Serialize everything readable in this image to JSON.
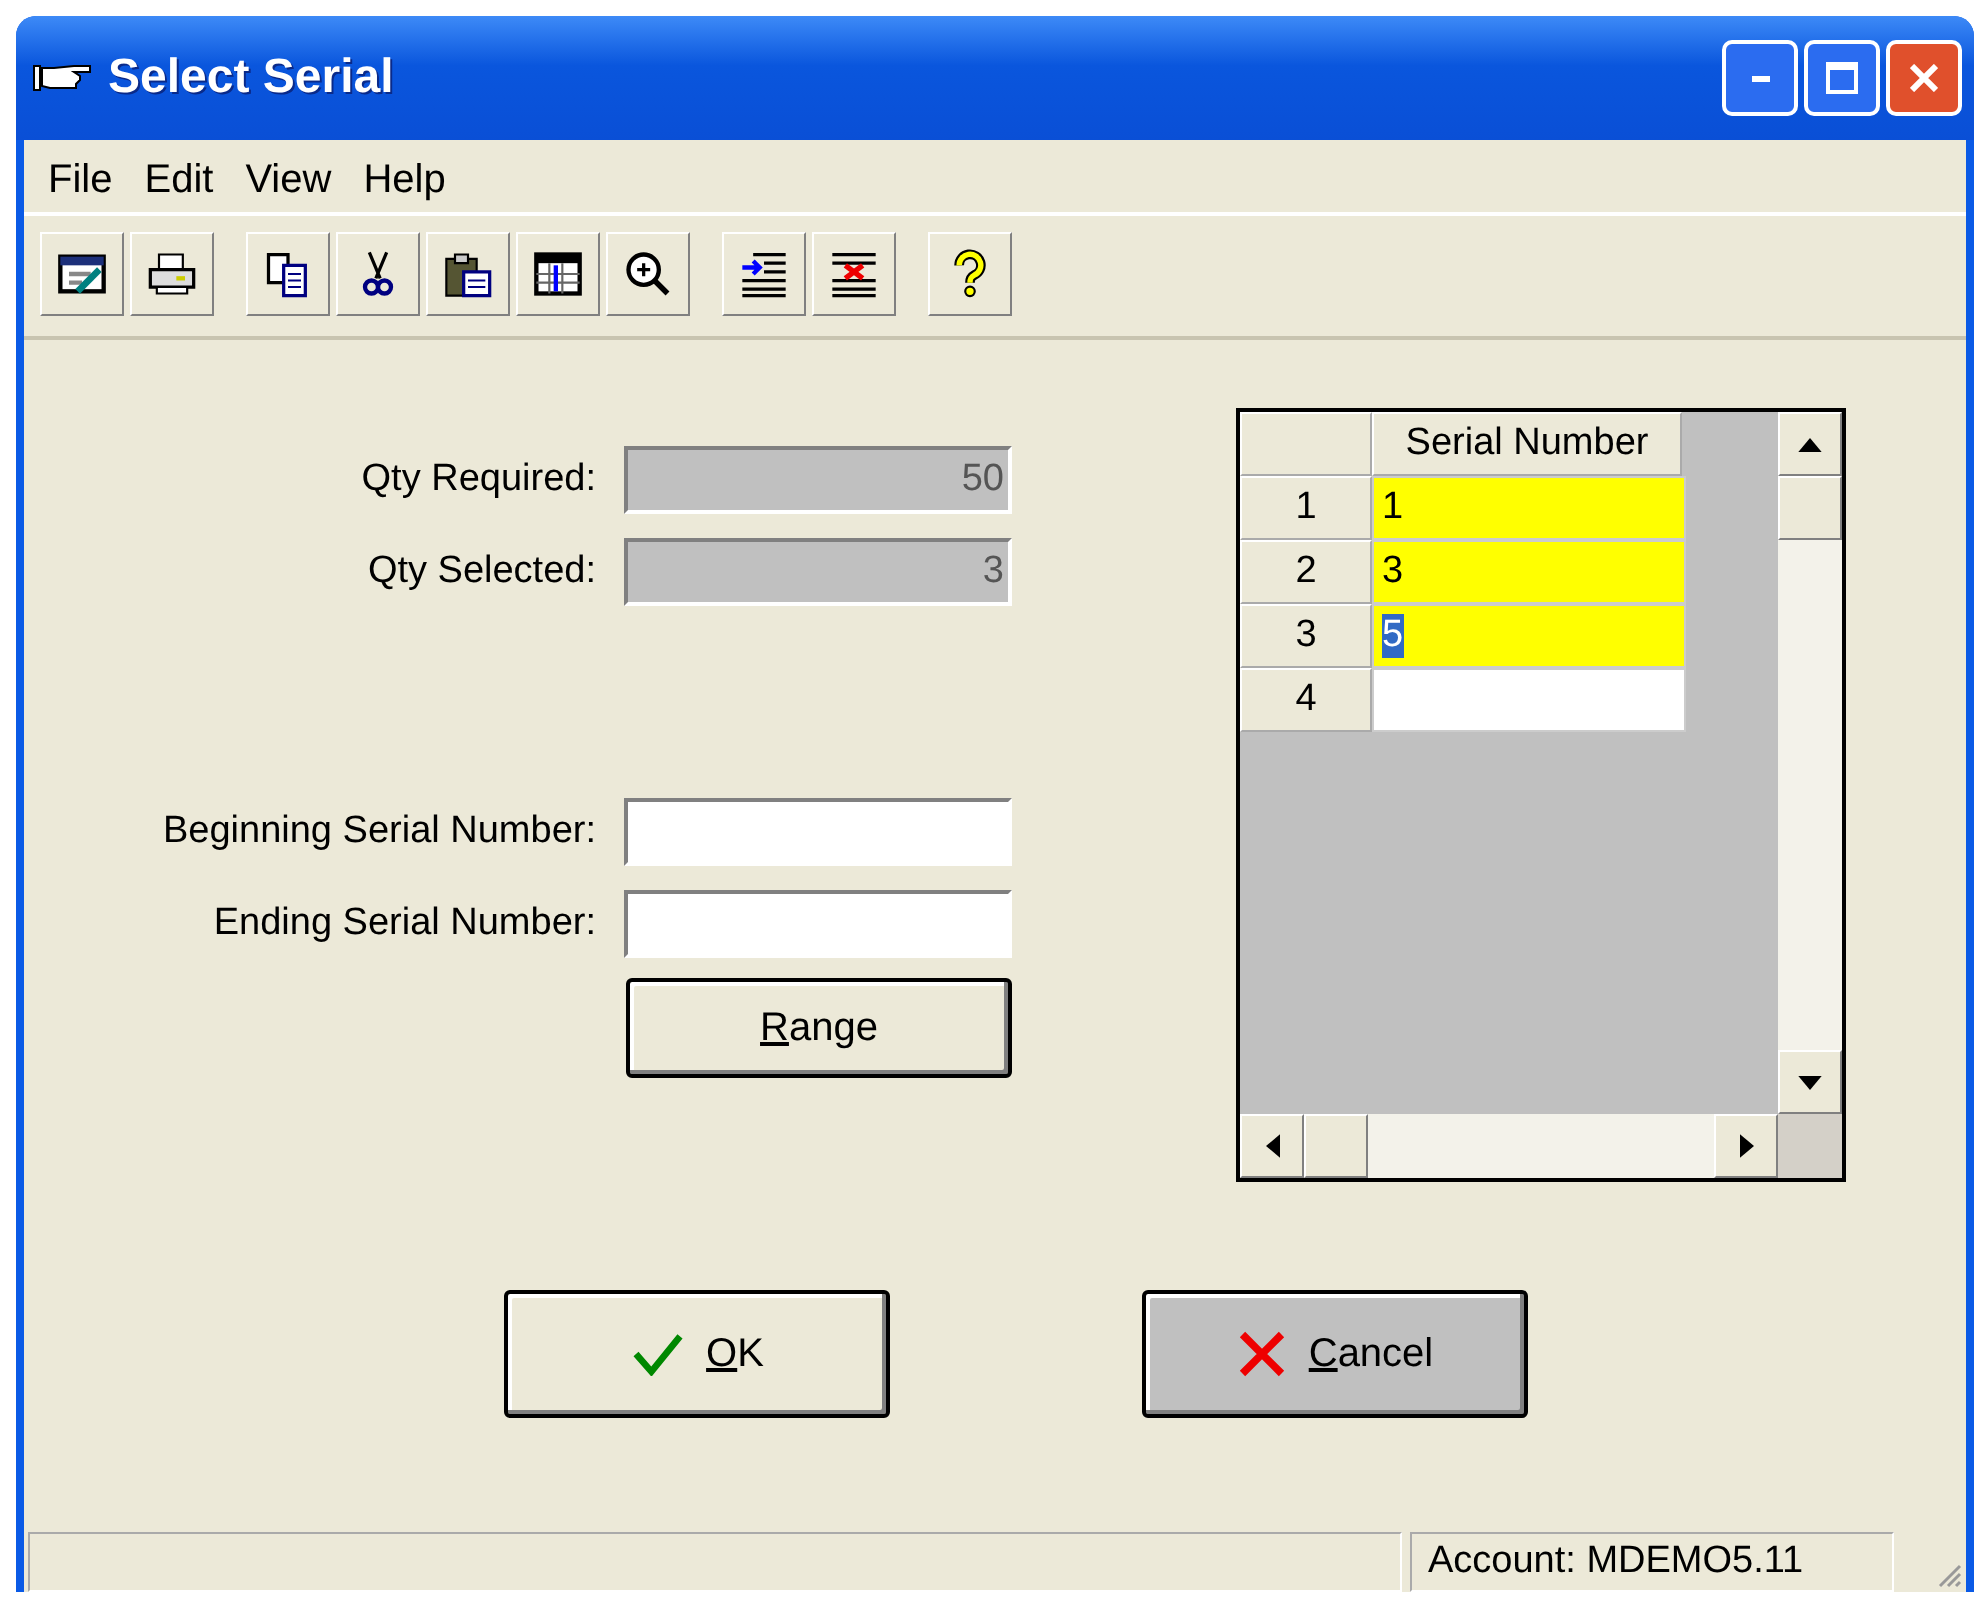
{
  "window": {
    "title": "Select Serial"
  },
  "menu": [
    "File",
    "Edit",
    "View",
    "Help"
  ],
  "toolbar_groups": [
    [
      {
        "kind": "form"
      },
      {
        "kind": "print"
      }
    ],
    [
      {
        "kind": "copy"
      },
      {
        "kind": "cut"
      },
      {
        "kind": "paste"
      },
      {
        "kind": "grid"
      },
      {
        "kind": "zoom"
      }
    ],
    [
      {
        "kind": "insert"
      },
      {
        "kind": "delete"
      }
    ],
    [
      {
        "kind": "help"
      }
    ]
  ],
  "qty_fields": [
    {
      "label": "Qty Required:",
      "value": "50",
      "disabled": true
    },
    {
      "label": "Qty Selected:",
      "value": "3",
      "disabled": true
    }
  ],
  "range_fields": [
    {
      "label": "Beginning Serial Number:",
      "disabled": false
    },
    {
      "label": "Ending Serial Number:",
      "disabled": false
    }
  ],
  "range_button": {
    "label": "Range",
    "mnemonic": true
  },
  "grid": {
    "columns": [
      "Serial Number"
    ],
    "rows": [
      {
        "number": "1",
        "value": "1",
        "highlighted": true,
        "text_selected": false
      },
      {
        "number": "2",
        "value": "3",
        "highlighted": true,
        "text_selected": false
      },
      {
        "number": "3",
        "value": "5",
        "highlighted": true,
        "text_selected": true
      },
      {
        "number": "4",
        "highlighted": false
      }
    ]
  },
  "buttons": [
    {
      "kind": "ok",
      "label": "OK",
      "mnemonic": true,
      "pressed": false
    },
    {
      "kind": "cancel",
      "label": "Cancel",
      "mnemonic": true,
      "pressed": true
    }
  ],
  "status_bar": {
    "account": "Account: MDEMO5.11"
  }
}
